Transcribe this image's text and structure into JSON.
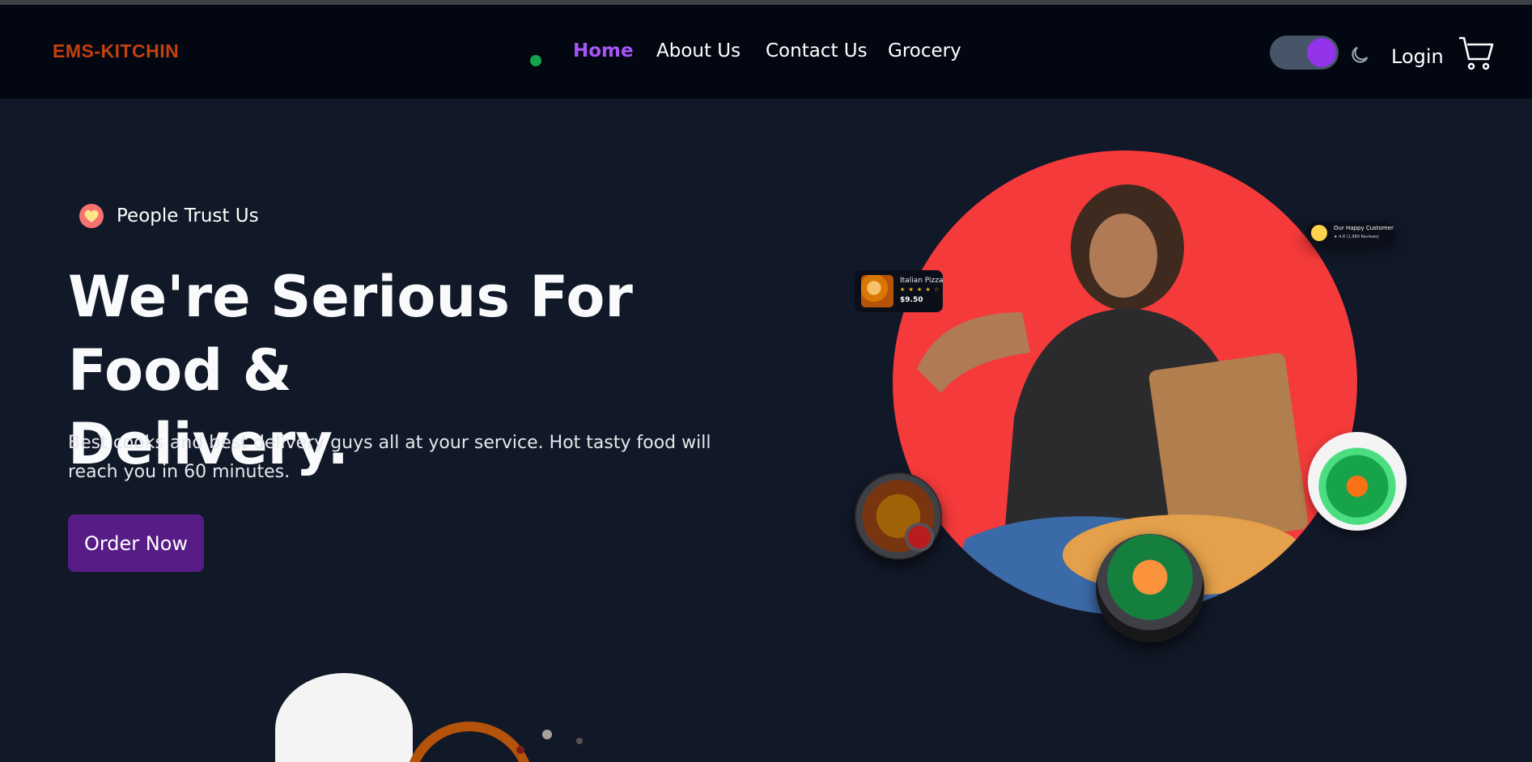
{
  "nav": {
    "logo": "EMS-KITCHIN",
    "links": [
      "Home",
      "About Us",
      "Contact Us",
      "Grocery"
    ],
    "active_link": "Home",
    "login": "Login",
    "theme_toggle_on": true
  },
  "hero": {
    "badge": "People Trust Us",
    "headline_line1": "We're Serious For Food &",
    "headline_line2": "Delivery.",
    "subtext": "Best cooks and best delivery guys all at your service. Hot tasty food will reach you in 60 minutes.",
    "cta": "Order Now"
  },
  "cards": {
    "pizza": {
      "name": "Italian Pizza",
      "stars": "★ ★ ★ ★ ☆",
      "price": "$9.50"
    },
    "customer": {
      "title": "Our Happy Customer",
      "rating": "★ 4.8 (1,989 Reviews)"
    }
  },
  "colors": {
    "background": "#111827",
    "navbar": "#030712",
    "logo": "#c2410c",
    "accent": "#a855f7",
    "button": "#581c87",
    "hero_circle": "#f43a3a"
  },
  "icons": [
    "heart-icon",
    "moon-icon",
    "cart-icon"
  ]
}
